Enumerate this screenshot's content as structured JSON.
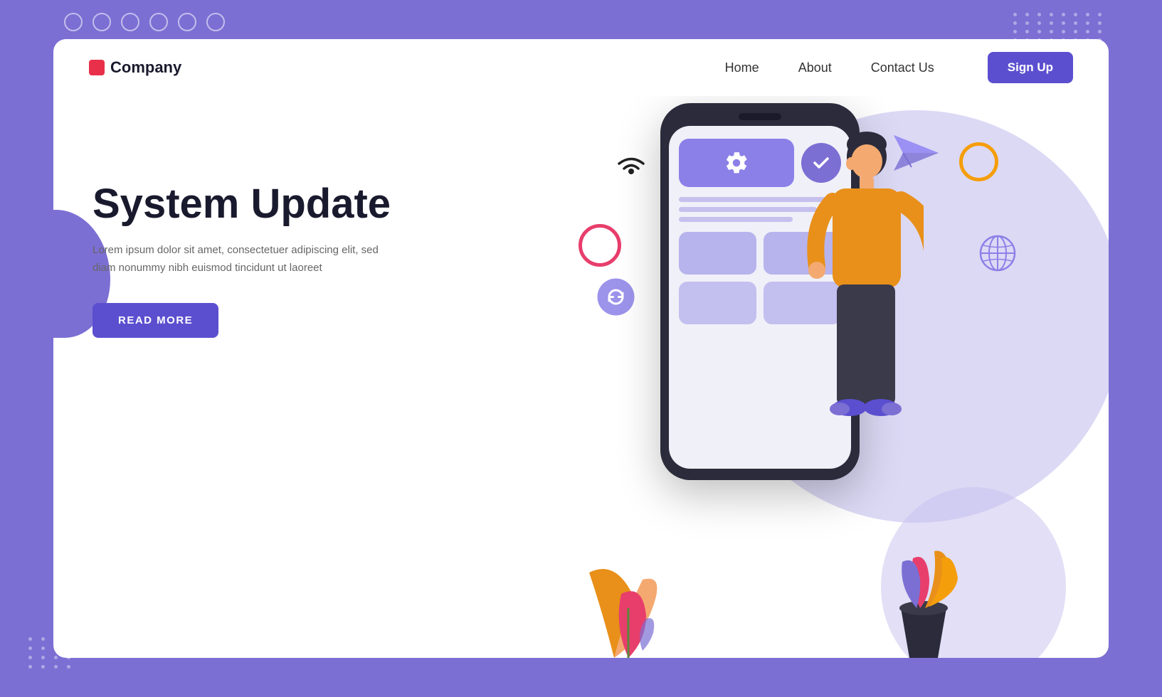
{
  "background_color": "#7B6FD4",
  "navbar": {
    "logo_text": "Company",
    "nav_items": [
      {
        "label": "Home",
        "id": "home"
      },
      {
        "label": "About",
        "id": "about"
      },
      {
        "label": "Contact Us",
        "id": "contact"
      }
    ],
    "cta_label": "Sign Up"
  },
  "hero": {
    "title": "System Update",
    "subtitle": "Lorem ipsum dolor sit amet, consectetuer adipiscing elit,\nsed diam nonummy nibh euismod tincidunt ut laoreet",
    "cta_label": "READ MORE"
  },
  "decoration": {
    "circles_count": 6,
    "dots_tr_count": 32,
    "dots_bl_count": 16
  },
  "phone": {
    "has_gear": true,
    "has_check": true,
    "lines_count": 3,
    "grid_items": 4
  }
}
